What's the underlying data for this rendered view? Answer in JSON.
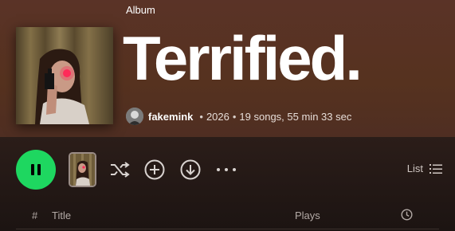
{
  "header": {
    "album_type": "Album",
    "title": "Terrified.",
    "artist": "fakemink",
    "year": "2026",
    "songs": "19 songs, 55 min 33 sec",
    "separator": "•"
  },
  "actions": {
    "play_state": "playing",
    "list_label": "List"
  },
  "table": {
    "hash": "#",
    "title": "Title",
    "plays": "Plays"
  },
  "colors": {
    "accent": "#1ed760",
    "header_bg": "#56321f"
  },
  "icons": [
    "pause-icon",
    "shuffle-icon",
    "add-icon",
    "download-icon",
    "more-icon",
    "list-icon",
    "clock-icon"
  ]
}
